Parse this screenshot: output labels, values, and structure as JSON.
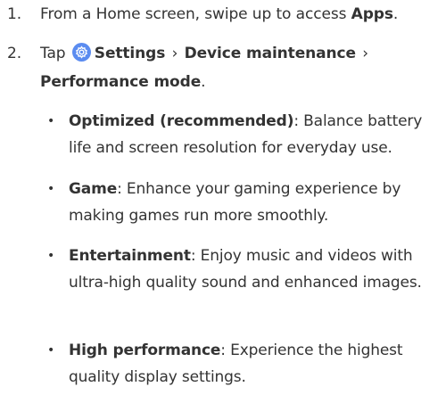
{
  "steps": [
    {
      "number": "1.",
      "text_before": "From a Home screen, swipe up to access ",
      "bold": "Apps",
      "text_after": "."
    },
    {
      "number": "2.",
      "tap_label": "Tap",
      "settings_icon": "settings-gear-icon",
      "settings_icon_color": "#5b8cf0",
      "path": [
        "Settings",
        "Device maintenance",
        "Performance mode"
      ],
      "separator": "›",
      "end_punct": "."
    }
  ],
  "modes": [
    {
      "name": "Optimized (recommended)",
      "description": "Balance battery life and screen resolution for everyday use."
    },
    {
      "name": "Game",
      "description": "Enhance your gaming experience by making games run more smoothly."
    },
    {
      "name": "Entertainment",
      "description": "Enjoy music and videos with ultra-high quality sound and enhanced images."
    },
    {
      "name": "High performance",
      "description": "Experience the highest quality display settings."
    }
  ],
  "bullet_char": "•"
}
